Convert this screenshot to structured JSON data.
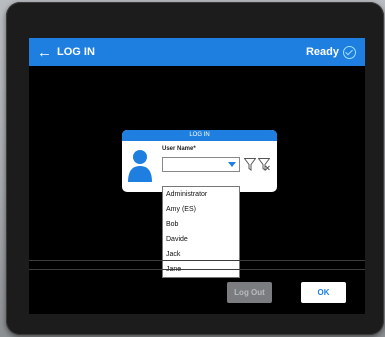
{
  "header": {
    "title": "LOG IN",
    "status": "Ready",
    "back_icon": "back-arrow-icon",
    "status_icon": "ready-check-icon",
    "accent_color": "#1f7fe0"
  },
  "dialog": {
    "title": "LOG IN",
    "user_label": "User Name*",
    "user_value": "",
    "user_icon": "user-silhouette-icon"
  },
  "dropdown": {
    "options": [
      "Administrator",
      "Amy (ES)",
      "Bob",
      "Davide",
      "Jack",
      "Jane"
    ]
  },
  "buttons": {
    "logout_label": "Log Out",
    "ok_label": "OK"
  }
}
